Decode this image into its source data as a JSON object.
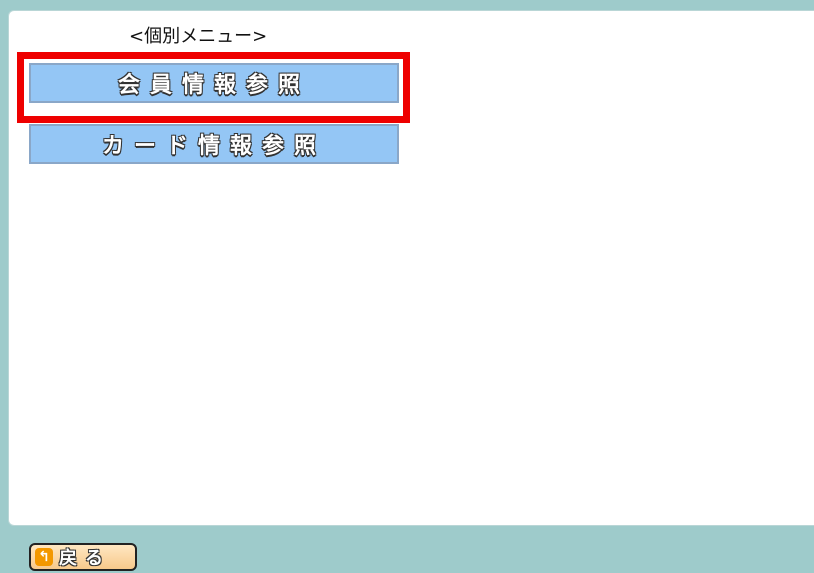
{
  "menu": {
    "title": "<個別メニュー>",
    "buttons": [
      {
        "label": "会員情報参照"
      },
      {
        "label": "カード情報参照"
      }
    ]
  },
  "footer": {
    "back_label": "戻る",
    "back_icon": "return-arrow-icon"
  },
  "colors": {
    "background": "#9ecbcb",
    "button": "#94c6f5",
    "highlight": "#ee0000",
    "back_button": "#f7c98b"
  }
}
